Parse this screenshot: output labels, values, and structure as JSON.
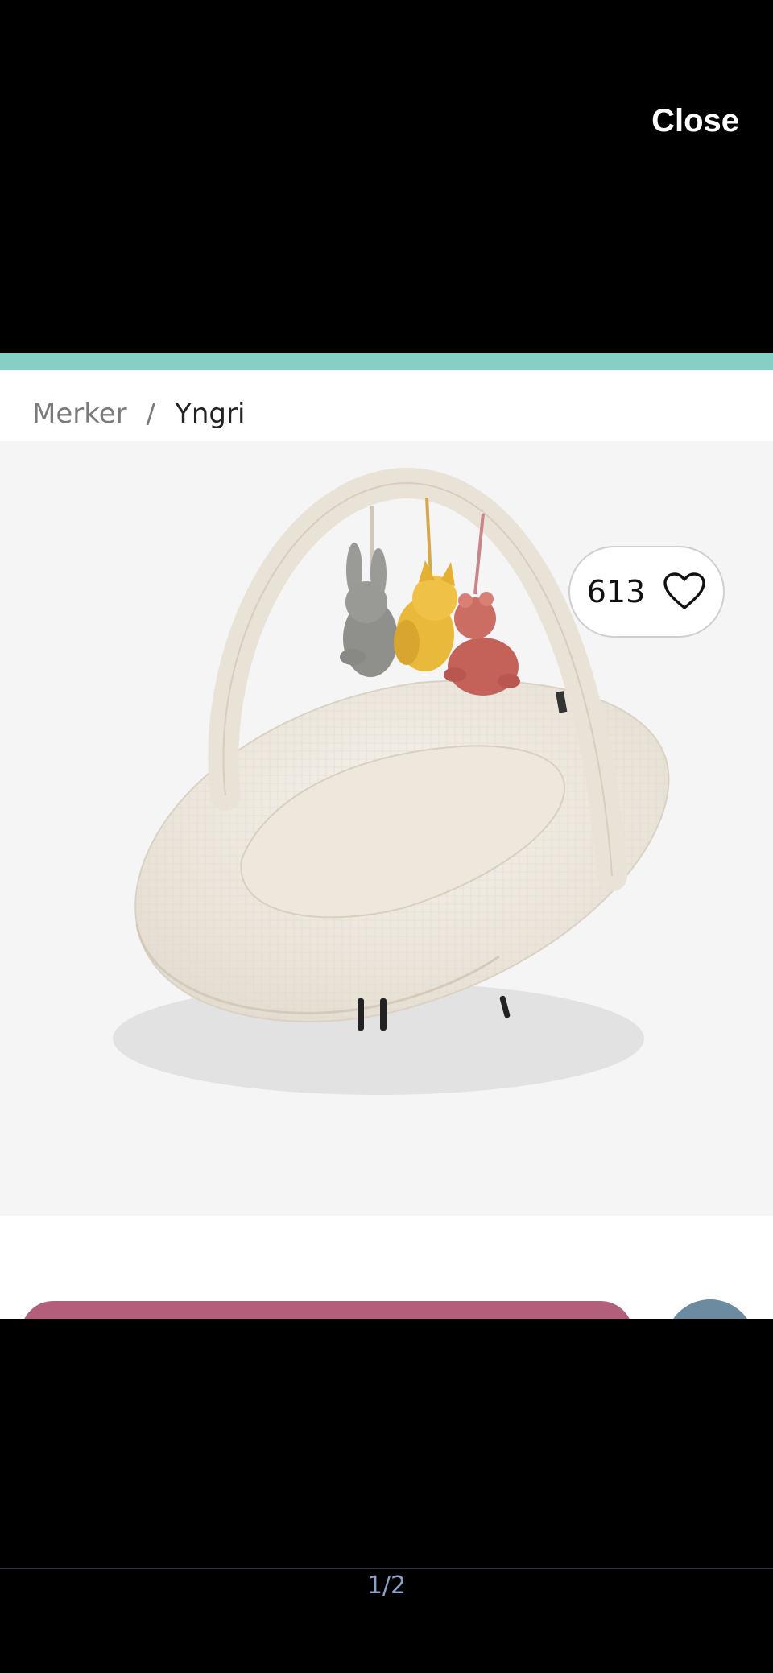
{
  "viewer": {
    "close_label": "Close",
    "pager": "1/2"
  },
  "breadcrumb": {
    "items": [
      "Merker",
      "Yngri"
    ],
    "separator": "/"
  },
  "product": {
    "likes": "613",
    "like_icon": "heart-icon",
    "image_alt": "baby nest with play arch and plush toys"
  },
  "colors": {
    "accent_teal": "#86cfc4",
    "buy_button": "#b35f7c",
    "round_button": "#6c8aa0"
  }
}
